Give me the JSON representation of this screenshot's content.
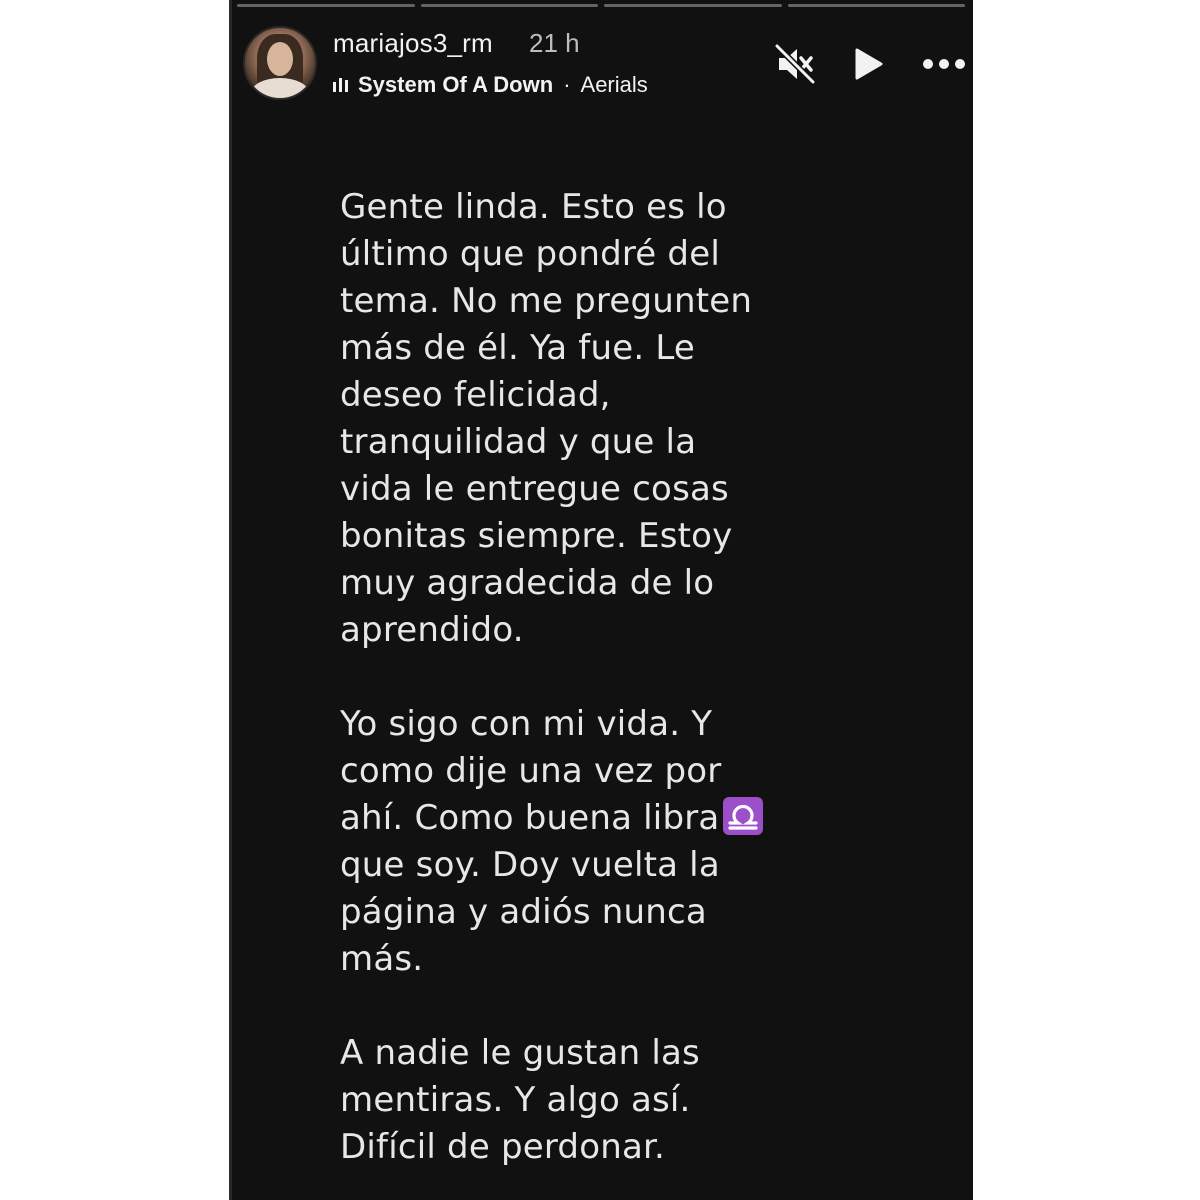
{
  "story": {
    "user": {
      "username": "mariajos3_rm",
      "time": "21 h"
    },
    "music": {
      "artist": "System Of A Down",
      "separator": "·",
      "song": "Aerials"
    },
    "controls": {
      "mute_icon": "speaker-muted-icon",
      "play_icon": "play-icon",
      "more_icon": "more-dots-icon"
    },
    "text": {
      "paragraph1": "Gente linda. Esto es lo\núltimo que pondré del\ntema. No me pregunten\nmás de él. Ya fue. Le\ndeseo felicidad,\ntranquilidad y que la\nvida le entregue cosas\nbonitas siempre. Estoy\nmuy agradecida de lo\naprendido.",
      "paragraph2_before_emoji": "Yo sigo con mi vida. Y\ncomo dije una vez por\nahí. Como buena libra",
      "paragraph2_emoji": "libra-zodiac-icon",
      "paragraph2_after_emoji": "\nque soy. Doy vuelta la\npágina y adiós nunca\nmás.",
      "paragraph3": "A nadie le gustan las\nmentiras. Y algo así.\nDifícil de perdonar."
    },
    "colors": {
      "background": "#111111",
      "text": "#e7e7e7",
      "libra_emoji": "#9b4fc9"
    }
  }
}
